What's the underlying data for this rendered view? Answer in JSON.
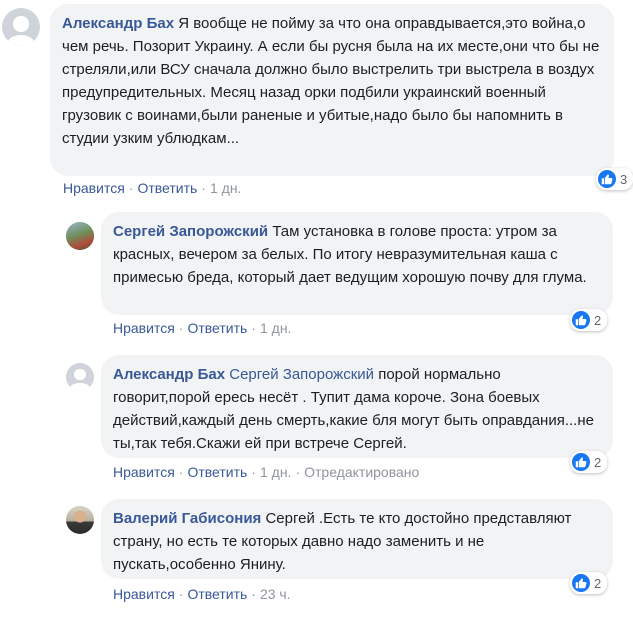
{
  "comments": [
    {
      "author": "Александр Бах",
      "mention": "",
      "text": "Я вообще не пойму за что она оправдывается,это война,о чем речь. Позорит Украину. А если бы русня была на их месте,они что бы не стреляли,или ВСУ сначала должно было выстрелить три выстрела в воздух предупредительных. Месяц назад орки подбили украинский военный грузовик с воинами,были раненые и убитые,надо было бы напомнить в студии узким ублюдкам...",
      "like_label": "Нравится",
      "reply_label": "Ответить",
      "time": "1 дн.",
      "edited": "",
      "reactions": "3",
      "reaction_icon": "like-icon"
    },
    {
      "author": "Сергей Запорожский",
      "mention": "",
      "text": "Там установка в голове проста: утром за красных, вечером за белых. По итогу невразумительная каша с примесью бреда, который дает ведущим хорошую почву для глума.",
      "like_label": "Нравится",
      "reply_label": "Ответить",
      "time": "1 дн.",
      "edited": "",
      "reactions": "2",
      "reaction_icon": "like-icon"
    },
    {
      "author": "Александр Бах",
      "mention": "Сергей Запорожский",
      "text": "порой нормально говорит,порой ересь несёт . Тупит дама короче. Зона боевых действий,каждый день смерть,какие бля могут быть оправдания...не ты,так тебя.Скажи ей при встрече Сергей.",
      "like_label": "Нравится",
      "reply_label": "Ответить",
      "time": "1 дн.",
      "edited": "Отредактировано",
      "reactions": "2",
      "reaction_icon": "like-icon"
    },
    {
      "author": "Валерий Габисония",
      "mention": "",
      "text": "Сергей .Есть те кто достойно представляют страну, но есть те которых давно надо заменить и не пускать,особенно Янину.",
      "like_label": "Нравится",
      "reply_label": "Ответить",
      "time": "23 ч.",
      "edited": "",
      "reactions": "2",
      "reaction_icon": "like-icon"
    }
  ],
  "colors": {
    "link": "#385898",
    "bubble": "#f2f3f5",
    "meta": "#90949c",
    "like_badge": "#1877f2"
  }
}
